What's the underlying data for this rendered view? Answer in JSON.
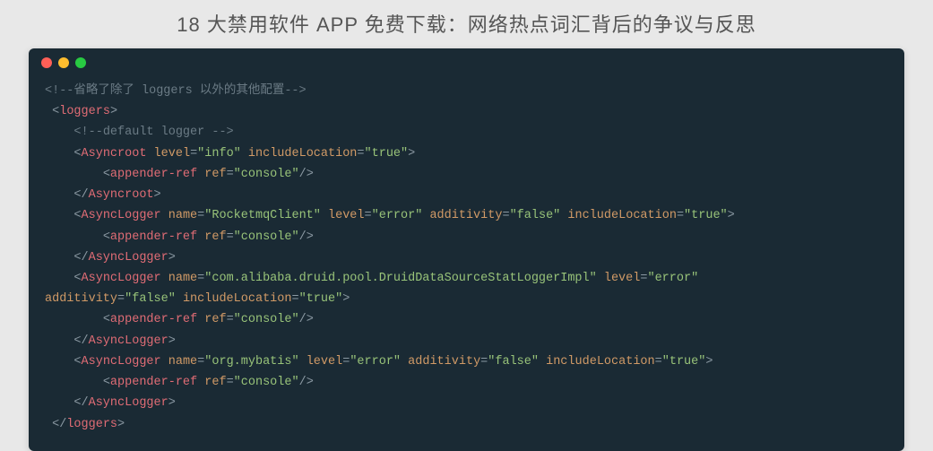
{
  "page_title": "18 大禁用软件 APP 免费下载：网络热点词汇背后的争议与反思",
  "dots": {
    "red": "#ff5f57",
    "yellow": "#ffbd2e",
    "green": "#28ca42"
  },
  "code": {
    "c1": "<!--省略了除了 loggers 以外的其他配置-->",
    "loggers_open": "loggers",
    "c2": " <!--default logger -->",
    "asyncroot": {
      "tag": "Asyncroot",
      "level_attr": "level",
      "level_val": "\"info\"",
      "inc_attr": "includeLocation",
      "inc_val": "\"true\""
    },
    "appender": {
      "tag": "appender-ref",
      "ref_attr": "ref",
      "ref_val": "\"console\""
    },
    "async1": {
      "tag": "AsyncLogger",
      "name_attr": "name",
      "name_val": "\"RocketmqClient\"",
      "level_attr": "level",
      "level_val": "\"error\"",
      "add_attr": "additivity",
      "add_val": "\"false\"",
      "inc_attr": "includeLocation",
      "inc_val": "\"true\""
    },
    "async2": {
      "tag": "AsyncLogger",
      "name_attr": "name",
      "name_val": "\"com.alibaba.druid.pool.DruidDataSourceStatLoggerImpl\"",
      "level_attr": "level",
      "level_val": "\"error\"",
      "add_attr": "additivity",
      "add_val": "\"false\"",
      "inc_attr": "includeLocation",
      "inc_val": "\"true\""
    },
    "async3": {
      "tag": "AsyncLogger",
      "name_attr": "name",
      "name_val": "\"org.mybatis\"",
      "level_attr": "level",
      "level_val": "\"error\"",
      "add_attr": "additivity",
      "add_val": "\"false\"",
      "inc_attr": "includeLocation",
      "inc_val": "\"true\""
    },
    "loggers_close": "loggers"
  }
}
